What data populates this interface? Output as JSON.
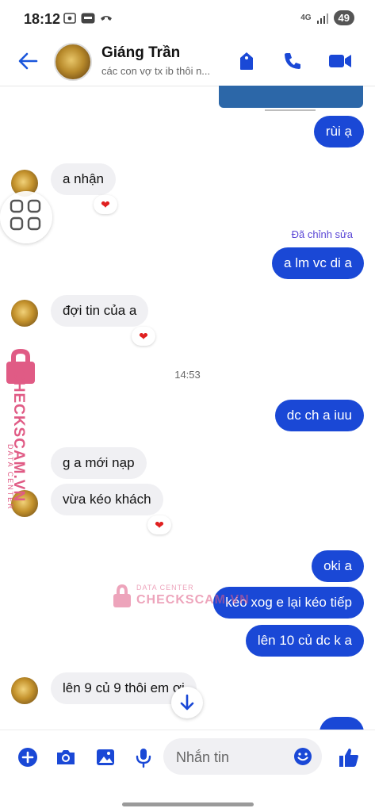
{
  "status_bar": {
    "time": "18:12",
    "network": "4G",
    "battery": "49"
  },
  "header": {
    "name": "Giáng Trần",
    "subtitle": "các con vợ tx ib thôi n..."
  },
  "messages": {
    "m1": "rùi ạ",
    "m2": "a nhận",
    "m3_edited": "Đã chỉnh sửa",
    "m3": "a lm vc di a",
    "m4": "đợi tin của a",
    "time_divider": "14:53",
    "m5": "dc ch a iuu",
    "m6": "g a mới nạp",
    "m7": "vừa kéo khách",
    "m8": "oki a",
    "m9": "kéo xog e lại kéo tiếp",
    "m10": "lên 10 củ dc k a",
    "m11": "lên 9 củ 9 thôi em ơi",
    "reaction": "❤"
  },
  "watermark": {
    "line1": "DATA CENTER",
    "line2": "CHECKSCAM.VN"
  },
  "composer": {
    "placeholder": "Nhắn tin"
  },
  "colors": {
    "accent": "#1a48d6",
    "incoming": "#f0f0f3",
    "heart": "#e02020",
    "watermark": "#e05b85"
  }
}
